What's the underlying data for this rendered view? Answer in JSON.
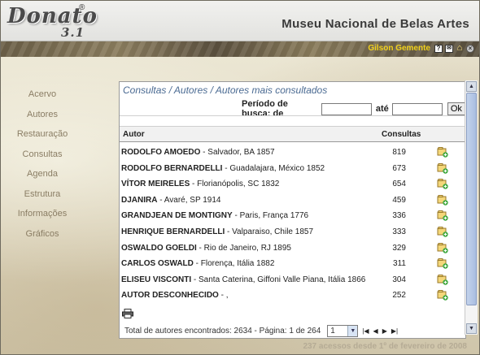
{
  "app": {
    "logo": "Donato",
    "logo_version": "3.1",
    "logo_reg": "®",
    "museum_title": "Museu Nacional de Belas Artes"
  },
  "user": {
    "name": "Gilson Gemente",
    "icons": [
      "help-icon",
      "mail-icon",
      "home-icon",
      "close-icon"
    ]
  },
  "sidebar": {
    "items": [
      {
        "label": "Acervo"
      },
      {
        "label": "Autores"
      },
      {
        "label": "Restauração"
      },
      {
        "label": "Consultas"
      },
      {
        "label": "Agenda"
      },
      {
        "label": "Estrutura"
      },
      {
        "label": "Informações"
      },
      {
        "label": "Gráficos"
      }
    ]
  },
  "panel": {
    "breadcrumb": "Consultas / Autores / Autores mais consultados",
    "period_label": "Período de busca: de",
    "until_label": "até",
    "from_value": "",
    "to_value": "",
    "ok_label": "Ok",
    "columns": {
      "autor": "Autor",
      "consultas": "Consultas"
    },
    "rows": [
      {
        "name": "RODOLFO AMOEDO",
        "detail": " - Salvador, BA 1857",
        "count": "819"
      },
      {
        "name": "RODOLFO BERNARDELLI",
        "detail": " - Guadalajara, México 1852",
        "count": "673"
      },
      {
        "name": "VÍTOR MEIRELES",
        "detail": " - Florianópolis, SC 1832",
        "count": "654"
      },
      {
        "name": "DJANIRA",
        "detail": " - Avaré, SP 1914",
        "count": "459"
      },
      {
        "name": "GRANDJEAN DE MONTIGNY",
        "detail": " - Paris, França 1776",
        "count": "336"
      },
      {
        "name": "HENRIQUE BERNARDELLI",
        "detail": " - Valparaiso, Chile 1857",
        "count": "333"
      },
      {
        "name": "OSWALDO GOELDI",
        "detail": " - Rio de Janeiro, RJ 1895",
        "count": "329"
      },
      {
        "name": "CARLOS OSWALD",
        "detail": " - Florença, Itália 1882",
        "count": "311"
      },
      {
        "name": "ELISEU VISCONTI",
        "detail": " - Santa Caterina, Giffoni Valle Piana, Itália 1866",
        "count": "304"
      },
      {
        "name": "AUTOR DESCONHECIDO",
        "detail": " - ,",
        "count": "252"
      }
    ],
    "footer_text": "Total de autores encontrados: 2634 - Página: 1 de 264",
    "page_value": "1",
    "pager": [
      "|◀",
      "◀",
      "▶",
      "▶|"
    ]
  },
  "access_text": "237 acessos desde 1º de fevereiro de 2008",
  "colors": {
    "breadcrumb": "#4a6a92",
    "nav_text": "#8a7d64",
    "user_name": "#f2d21c"
  }
}
